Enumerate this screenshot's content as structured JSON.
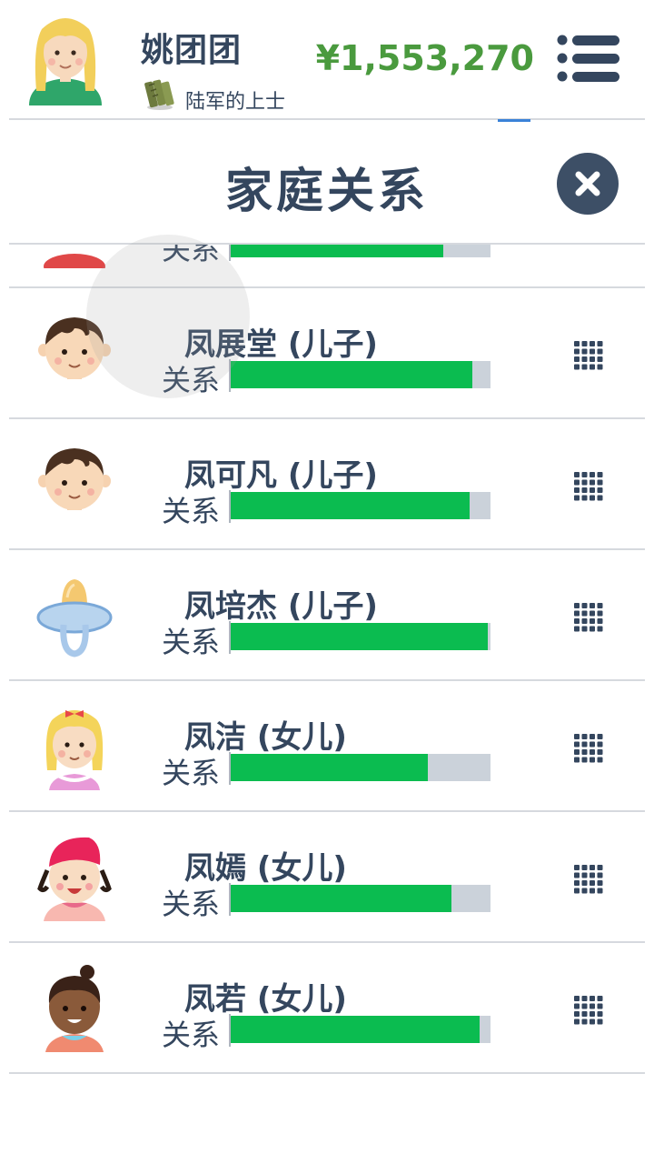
{
  "header": {
    "player_name": "姚团团",
    "rank": "陆军的上士",
    "money": "¥1,553,270"
  },
  "page": {
    "title": "家庭关系"
  },
  "members": [
    {
      "name": "",
      "relationship_label": "关系",
      "relationship": 0.82,
      "avatar": "partial-avatar-red"
    },
    {
      "name": "凤展堂 (儿子)",
      "relationship_label": "关系",
      "relationship": 0.93,
      "avatar": "boy-face-icon"
    },
    {
      "name": "凤可凡 (儿子)",
      "relationship_label": "关系",
      "relationship": 0.92,
      "avatar": "boy-face-icon"
    },
    {
      "name": "凤培杰 (儿子)",
      "relationship_label": "关系",
      "relationship": 0.99,
      "avatar": "pacifier-icon"
    },
    {
      "name": "凤洁 (女儿)",
      "relationship_label": "关系",
      "relationship": 0.76,
      "avatar": "blonde-girl-icon"
    },
    {
      "name": "凤嫣 (女儿)",
      "relationship_label": "关系",
      "relationship": 0.85,
      "avatar": "girl-pink-hat-icon"
    },
    {
      "name": "凤若 (女儿)",
      "relationship_label": "关系",
      "relationship": 0.96,
      "avatar": "girl-dark-skin-icon"
    }
  ],
  "colors": {
    "money": "#4a9a3e",
    "bar_fill": "#0bbc50",
    "bar_track": "#cbd2da",
    "text": "#34465e"
  }
}
